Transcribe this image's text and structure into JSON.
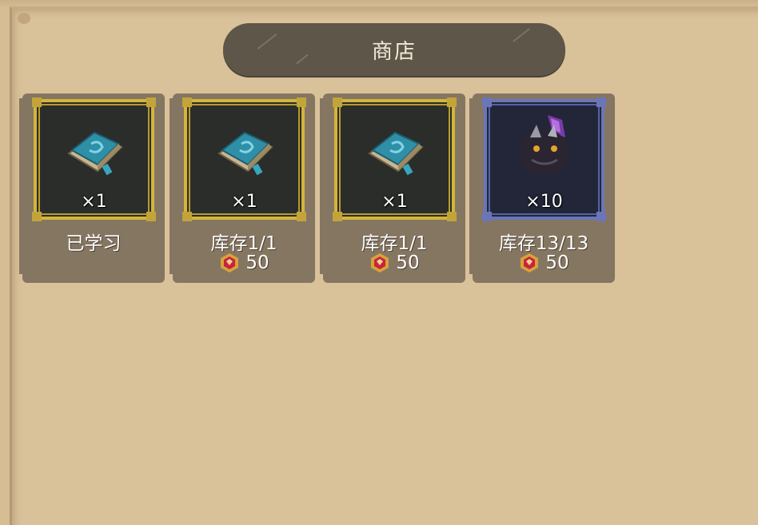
{
  "shop": {
    "title": "商店"
  },
  "items": [
    {
      "icon": "blue-book-icon",
      "quantity": "×1",
      "status": "已学习",
      "price": "",
      "frame": "gold"
    },
    {
      "icon": "blue-book-icon",
      "quantity": "×1",
      "status": "库存1/1",
      "price": "50",
      "frame": "gold"
    },
    {
      "icon": "blue-book-icon",
      "quantity": "×1",
      "status": "库存1/1",
      "price": "50",
      "frame": "gold"
    },
    {
      "icon": "dark-crystal-creature-icon",
      "quantity": "×10",
      "status": "库存13/13",
      "price": "50",
      "frame": "blue"
    }
  ],
  "colors": {
    "background": "#d9c19a",
    "title_bar": "#5e5648",
    "card": "#857662",
    "gold_frame": "#d3b53a",
    "blue_frame": "#6a76b8",
    "coin": "#c8243a"
  }
}
